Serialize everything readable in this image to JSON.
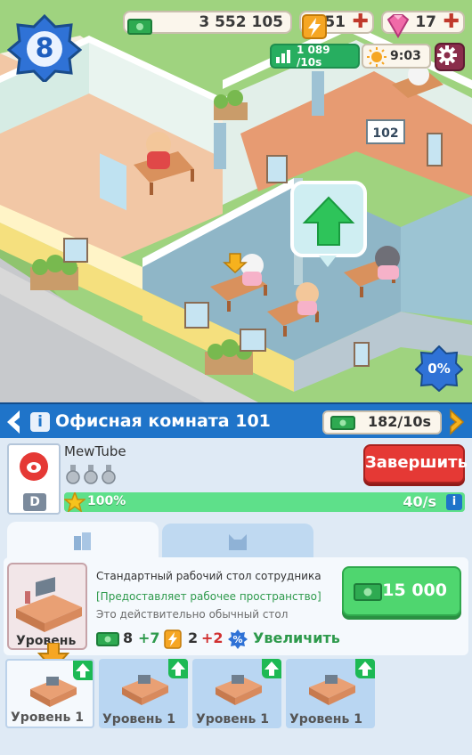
{
  "hud": {
    "level": "8",
    "money": "3 552 105",
    "energy": "51",
    "gems": "17",
    "income_rate": "1 089 /10s",
    "time": "9:03",
    "room_progress": "0%"
  },
  "scene": {
    "room_number_sign": "102"
  },
  "room": {
    "title": "Офисная комната 101",
    "income": "182/10s"
  },
  "project": {
    "name": "MewTube",
    "grade": "D",
    "finish_label": "Завершить",
    "progress_percent": "100%",
    "progress_fraction": 1.0,
    "rate": "40/s"
  },
  "item": {
    "name": "Стандартный рабочий стол сотрудника",
    "description_effect": "[Предоставляет рабочее пространство]",
    "description_flavor": "Это действительно обычный стол",
    "current_level": "Уровень 2",
    "price": "15 000",
    "stat_money": "8",
    "stat_money_bonus": "+7",
    "stat_energy": "2",
    "stat_energy_bonus": "+2",
    "boost_label": "Увеличить"
  },
  "level_cards": [
    {
      "label": "Уровень 1"
    },
    {
      "label": "Уровень 1"
    },
    {
      "label": "Уровень 1"
    },
    {
      "label": "Уровень 1"
    }
  ],
  "colors": {
    "header_blue": "#1f74c9",
    "finish_red": "#e53935",
    "buy_green": "#4fd66f",
    "progress_green": "#5ee08a"
  }
}
